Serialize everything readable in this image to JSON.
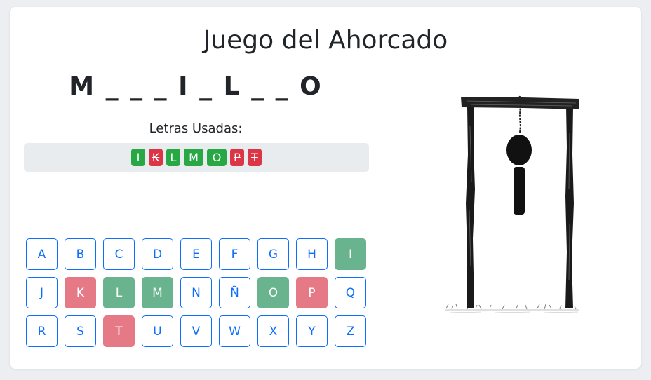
{
  "title": "Juego del Ahorcado",
  "word_display": "M _ _ _ I _ L _ _ O",
  "used_label": "Letras Usadas:",
  "used_letters": [
    {
      "letter": "I",
      "status": "correct"
    },
    {
      "letter": "K",
      "status": "wrong"
    },
    {
      "letter": "L",
      "status": "correct"
    },
    {
      "letter": "M",
      "status": "correct"
    },
    {
      "letter": "O",
      "status": "correct"
    },
    {
      "letter": "P",
      "status": "wrong"
    },
    {
      "letter": "T",
      "status": "wrong"
    }
  ],
  "keyboard": [
    [
      {
        "letter": "A",
        "status": "unused"
      },
      {
        "letter": "B",
        "status": "unused"
      },
      {
        "letter": "C",
        "status": "unused"
      },
      {
        "letter": "D",
        "status": "unused"
      },
      {
        "letter": "E",
        "status": "unused"
      },
      {
        "letter": "F",
        "status": "unused"
      },
      {
        "letter": "G",
        "status": "unused"
      },
      {
        "letter": "H",
        "status": "unused"
      },
      {
        "letter": "I",
        "status": "correct"
      }
    ],
    [
      {
        "letter": "J",
        "status": "unused"
      },
      {
        "letter": "K",
        "status": "wrong"
      },
      {
        "letter": "L",
        "status": "correct"
      },
      {
        "letter": "M",
        "status": "correct"
      },
      {
        "letter": "N",
        "status": "unused"
      },
      {
        "letter": "Ñ",
        "status": "unused"
      },
      {
        "letter": "O",
        "status": "correct"
      },
      {
        "letter": "P",
        "status": "wrong"
      },
      {
        "letter": "Q",
        "status": "unused"
      }
    ],
    [
      {
        "letter": "R",
        "status": "unused"
      },
      {
        "letter": "S",
        "status": "unused"
      },
      {
        "letter": "T",
        "status": "wrong"
      },
      {
        "letter": "U",
        "status": "unused"
      },
      {
        "letter": "V",
        "status": "unused"
      },
      {
        "letter": "W",
        "status": "unused"
      },
      {
        "letter": "X",
        "status": "unused"
      },
      {
        "letter": "Y",
        "status": "unused"
      },
      {
        "letter": "Z",
        "status": "unused"
      }
    ]
  ],
  "colors": {
    "accent": "#0d6efd",
    "correct_chip": "#28a745",
    "wrong_chip": "#dc3545",
    "correct_key": "#69b38e",
    "wrong_key": "#e57986"
  },
  "gallows_stage": 2
}
